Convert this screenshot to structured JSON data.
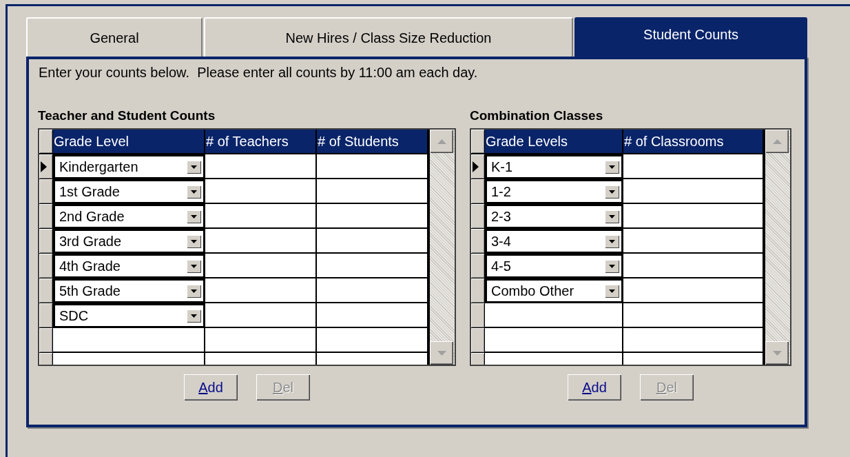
{
  "tabs": [
    {
      "label": "General",
      "selected": false
    },
    {
      "label": "New Hires / Class Size Reduction",
      "selected": false
    },
    {
      "label": "Student Counts",
      "selected": true
    }
  ],
  "instructions": "Enter your counts below.  Please enter all counts by 11:00 am each day.",
  "sections": [
    {
      "title": "Teacher and Student Counts",
      "columns": [
        "Grade Level",
        "# of Teachers",
        "# of Students"
      ],
      "rows": [
        {
          "grade": "Kindergarten",
          "selected": true
        },
        {
          "grade": "1st Grade",
          "selected": false
        },
        {
          "grade": "2nd Grade",
          "selected": false
        },
        {
          "grade": "3rd Grade",
          "selected": false
        },
        {
          "grade": "4th Grade",
          "selected": false
        },
        {
          "grade": "5th Grade",
          "selected": false
        },
        {
          "grade": "SDC",
          "selected": false
        },
        {
          "selected": false
        },
        {
          "selected": false
        }
      ],
      "buttons": [
        {
          "label": "Add",
          "disabled": false
        },
        {
          "label": "Del",
          "disabled": true
        }
      ]
    },
    {
      "title": "Combination Classes",
      "columns": [
        "Grade Levels",
        "# of Classrooms"
      ],
      "rows": [
        {
          "grade": "K-1",
          "selected": true
        },
        {
          "grade": "1-2",
          "selected": false
        },
        {
          "grade": "2-3",
          "selected": false
        },
        {
          "grade": "3-4",
          "selected": false
        },
        {
          "grade": "4-5",
          "selected": false
        },
        {
          "grade": "Combo Other",
          "selected": false
        },
        {
          "selected": false
        },
        {
          "selected": false
        },
        {
          "selected": false
        }
      ],
      "buttons": [
        {
          "label": "Add",
          "disabled": false
        },
        {
          "label": "Del",
          "disabled": true
        }
      ]
    }
  ]
}
